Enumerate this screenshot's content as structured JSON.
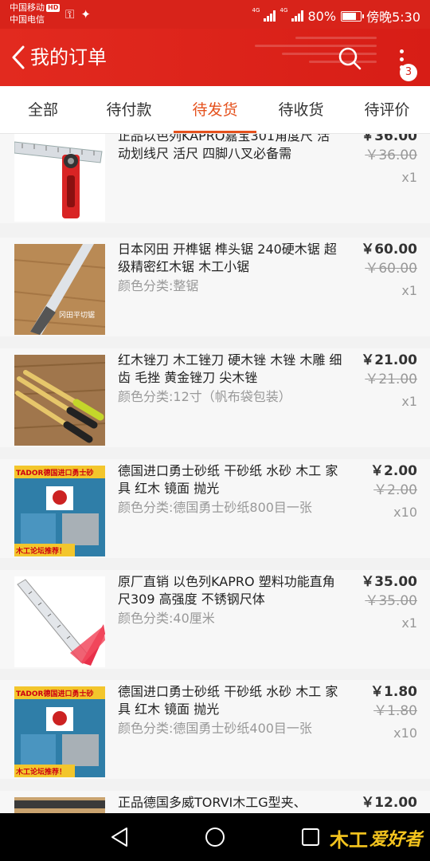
{
  "status_bar": {
    "carrier1": "中国移动",
    "hd": "HD",
    "carrier2": "中国电信",
    "net1": "4G",
    "net2": "4G",
    "battery": "80%",
    "battery_level": 0.8,
    "time": "傍晚5:30"
  },
  "header": {
    "title": "我的订单",
    "badge": "3"
  },
  "tabs": [
    {
      "label": "全部"
    },
    {
      "label": "待付款"
    },
    {
      "label": "待发货"
    },
    {
      "label": "待收货"
    },
    {
      "label": "待评价"
    }
  ],
  "active_tab": "待发货",
  "orders": [
    {
      "name": "正品以色列KAPRO嘉宝301角度尺 活动划线尺 活尺 四脚八叉必备需",
      "variant": "",
      "price": "￥36.00",
      "original_price": "￥36.00",
      "qty": "x1",
      "image": "angle-ruler"
    },
    {
      "name": "日本冈田 开榫锯 榫头锯 240硬木锯 超级精密红木锯 木工小锯",
      "variant": "颜色分类:整锯",
      "price": "￥60.00",
      "original_price": "￥60.00",
      "qty": "x1",
      "image": "saw"
    },
    {
      "name": "红木锉刀 木工锉刀 硬木锉 木锉 木雕 细齿 毛挫 黄金锉刀 尖木锉",
      "variant": "颜色分类:12寸（帆布袋包装）",
      "price": "￥21.00",
      "original_price": "￥21.00",
      "qty": "x1",
      "image": "files"
    },
    {
      "name": "德国进口勇士砂纸 干砂纸 水砂 木工  家具 红木 镜面 抛光",
      "variant": "颜色分类:德国勇士砂纸800目一张",
      "price": "￥2.00",
      "original_price": "￥2.00",
      "qty": "x10",
      "image": "sandpaper"
    },
    {
      "name": "原厂直销 以色列KAPRO 塑料功能直角尺309 高强度 不锈钢尺体",
      "variant": "颜色分类:40厘米",
      "price": "￥35.00",
      "original_price": "￥35.00",
      "qty": "x1",
      "image": "square"
    },
    {
      "name": "德国进口勇士砂纸 干砂纸 水砂 木工  家具 红木 镜面 抛光",
      "variant": "颜色分类:德国勇士砂纸400目一张",
      "price": "￥1.80",
      "original_price": "￥1.80",
      "qty": "x10",
      "image": "sandpaper"
    },
    {
      "name": "正品德国多威TORVI木工G型夹、",
      "variant": "",
      "price": "￥12.00",
      "original_price": "",
      "qty": "",
      "image": "clamp"
    }
  ],
  "image_text": {
    "sandpaper_banner": "TADOR德国进口勇士砂",
    "sandpaper_footer": "木工论坛推荐！",
    "saw_label": "冈田平切锯"
  },
  "watermark": {
    "logo": "木工",
    "text": "爱好者"
  },
  "colors": {
    "brand_red": "#d8231a",
    "active_tab": "#e5511d"
  }
}
